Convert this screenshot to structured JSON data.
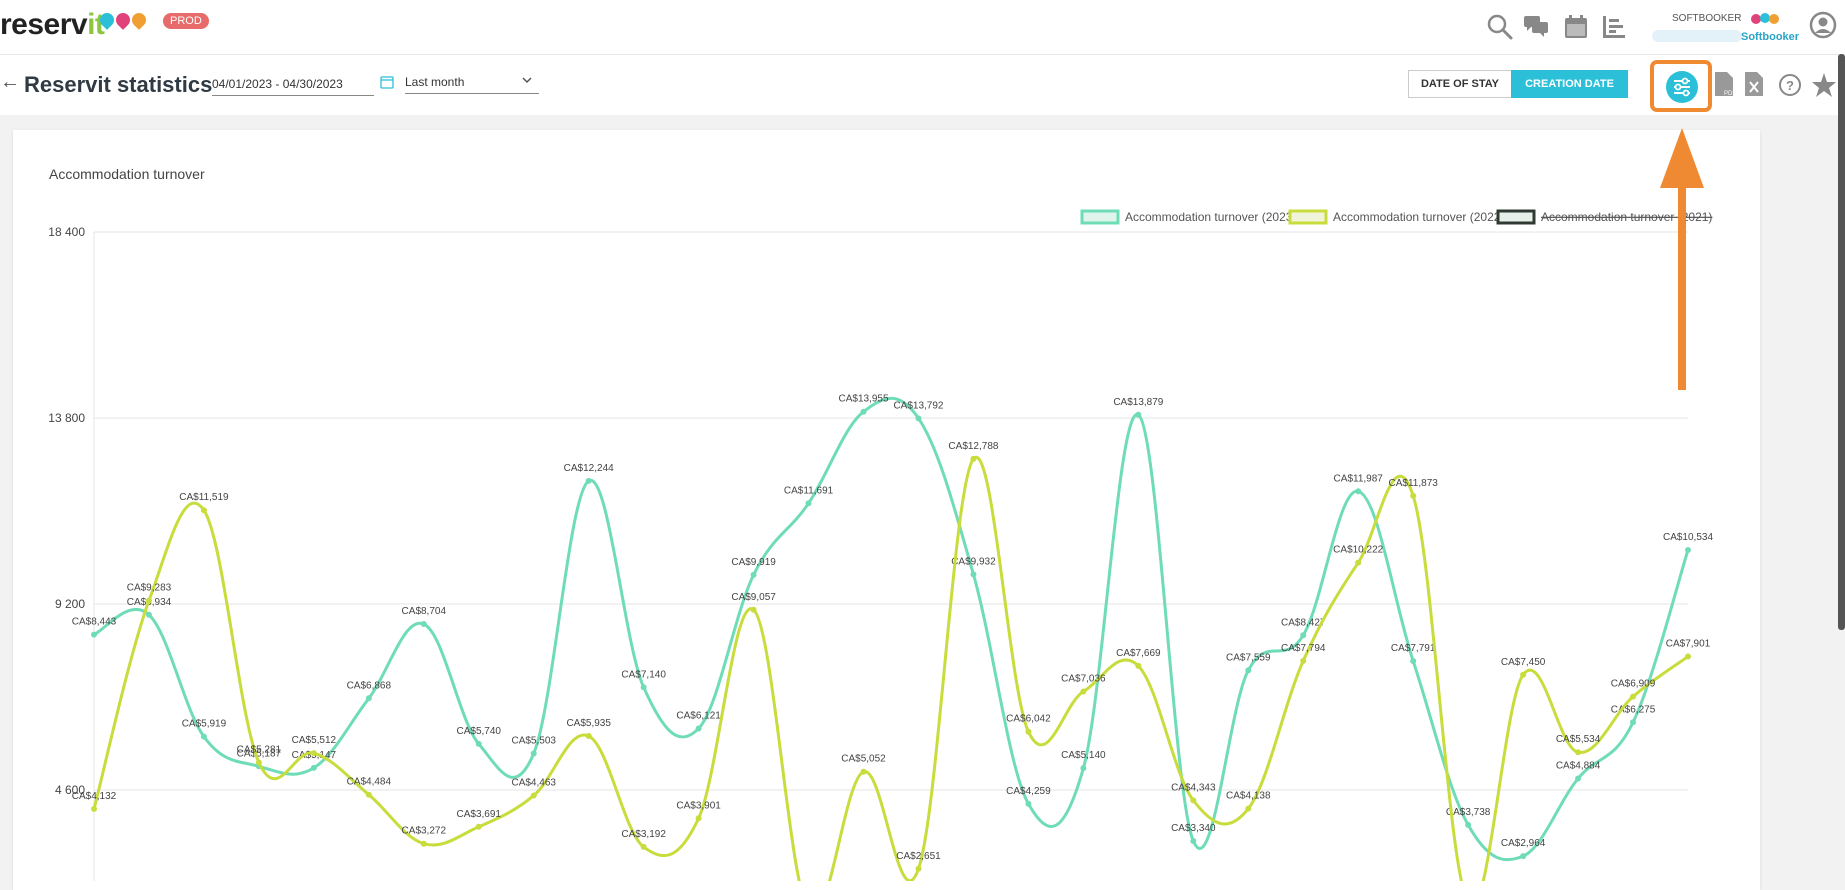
{
  "header": {
    "logo_main": "reserv",
    "logo_accent": "it",
    "env_badge": "PROD",
    "brand_label": "SOFTBOOKER",
    "brand_logo_word": "Softbooker",
    "icons": [
      "search-icon",
      "chat-icon",
      "calendar-icon",
      "stats-icon",
      "user-avatar-icon"
    ]
  },
  "toolbar": {
    "title": "Reservit statistics",
    "date_range": "04/01/2023 - 04/30/2023",
    "period": "Last month",
    "date_of_stay_label": "DATE OF STAY",
    "creation_date_label": "CREATION DATE",
    "icons": [
      "back-arrow-icon",
      "settings-sliders-icon",
      "pdf-export-icon",
      "excel-export-icon",
      "help-icon",
      "favorite-star-icon"
    ]
  },
  "colors": {
    "accent": "#2bc0d8",
    "series_2023": "#6fdcb8",
    "series_2022": "#c8dc3c",
    "highlight": "#f08a32",
    "badge": "#e76b6b"
  },
  "chart_data": {
    "type": "line",
    "title": "Accommodation turnover",
    "ylim": [
      4600,
      18400
    ],
    "y_ticks": [
      "18 400",
      "13 800",
      "9 200",
      "4 600"
    ],
    "grid": true,
    "legend_position": "top-right",
    "legend": [
      "Accommodation turnover (2023)",
      "Accommodation turnover (2022)",
      "Accommodation turnover (2021)"
    ],
    "series": [
      {
        "name": "Accommodation turnover (2023)",
        "color": "#6fdcb8",
        "values": [
          8443,
          8934,
          5919,
          5187,
          5147,
          6868,
          8704,
          5740,
          5503,
          12244,
          7140,
          6121,
          9919,
          11691,
          13955,
          13792,
          9932,
          4259,
          5140,
          13879,
          3340,
          7559,
          8427,
          11987,
          7791,
          3738,
          2964,
          4884,
          6275,
          10534
        ],
        "labels": [
          "CA$8,443",
          "CA$8,934",
          "CA$5,919",
          "CA$5,187",
          "CA$5,147",
          "CA$6,868",
          "CA$8,704",
          "CA$5,740",
          "CA$5,503",
          "CA$12,244",
          "CA$7,140",
          "CA$6,121",
          "CA$9,919",
          "CA$11,691",
          "CA$13,955",
          "CA$13,792",
          "CA$9,932",
          "CA$4,259",
          "CA$5,140",
          "CA$13,879",
          "CA$3,340",
          "CA$7,559",
          "CA$8,427",
          "CA$11,987",
          "CA$7,791",
          "CA$3,738",
          "CA$2,964",
          "CA$4,884",
          "CA$6,275",
          "CA$10,534"
        ]
      },
      {
        "name": "Accommodation turnover (2022)",
        "color": "#c8dc3c",
        "values": [
          4132,
          9283,
          11519,
          5281,
          5512,
          4484,
          3272,
          3691,
          4463,
          5935,
          3192,
          3901,
          9057,
          1600,
          5052,
          2651,
          12788,
          6042,
          7036,
          7669,
          4343,
          4138,
          7794,
          10222,
          11873,
          1800,
          7450,
          5534,
          6909,
          7901
        ],
        "labels": [
          "CA$4,132",
          "CA$9,283",
          "CA$11,519",
          "CA$5,281",
          "CA$5,512",
          "CA$4,484",
          "CA$3,272",
          "CA$3,691",
          "CA$4,463",
          "CA$5,935",
          "CA$3,192",
          "CA$3,901",
          "CA$9,057",
          "",
          "CA$5,052",
          "CA$2,651",
          "CA$12,788",
          "CA$6,042",
          "CA$7,036",
          "CA$7,669",
          "CA$4,343",
          "CA$4,138",
          "CA$7,794",
          "CA$10,222",
          "CA$11,873",
          "",
          "CA$7,450",
          "CA$5,534",
          "CA$6,909",
          "CA$7,901"
        ]
      }
    ]
  }
}
